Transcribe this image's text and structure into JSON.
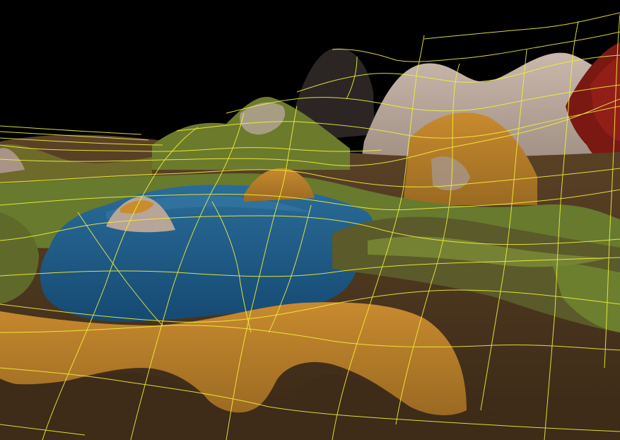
{
  "scene": {
    "kind": "3d-terrain-editor-viewport",
    "wireframe_overlay": true,
    "wireframe_color": "#f2f03a",
    "sky_color": "#000000",
    "water_color": "#1d5a86",
    "grass_color": "#6f8a2c",
    "dry_grass_color": "#b8802a",
    "dirt_color": "#4a3420",
    "rock_color": "#b8a598",
    "dark_rock_color": "#2a2522",
    "lava_rock_color": "#8a1a14"
  }
}
